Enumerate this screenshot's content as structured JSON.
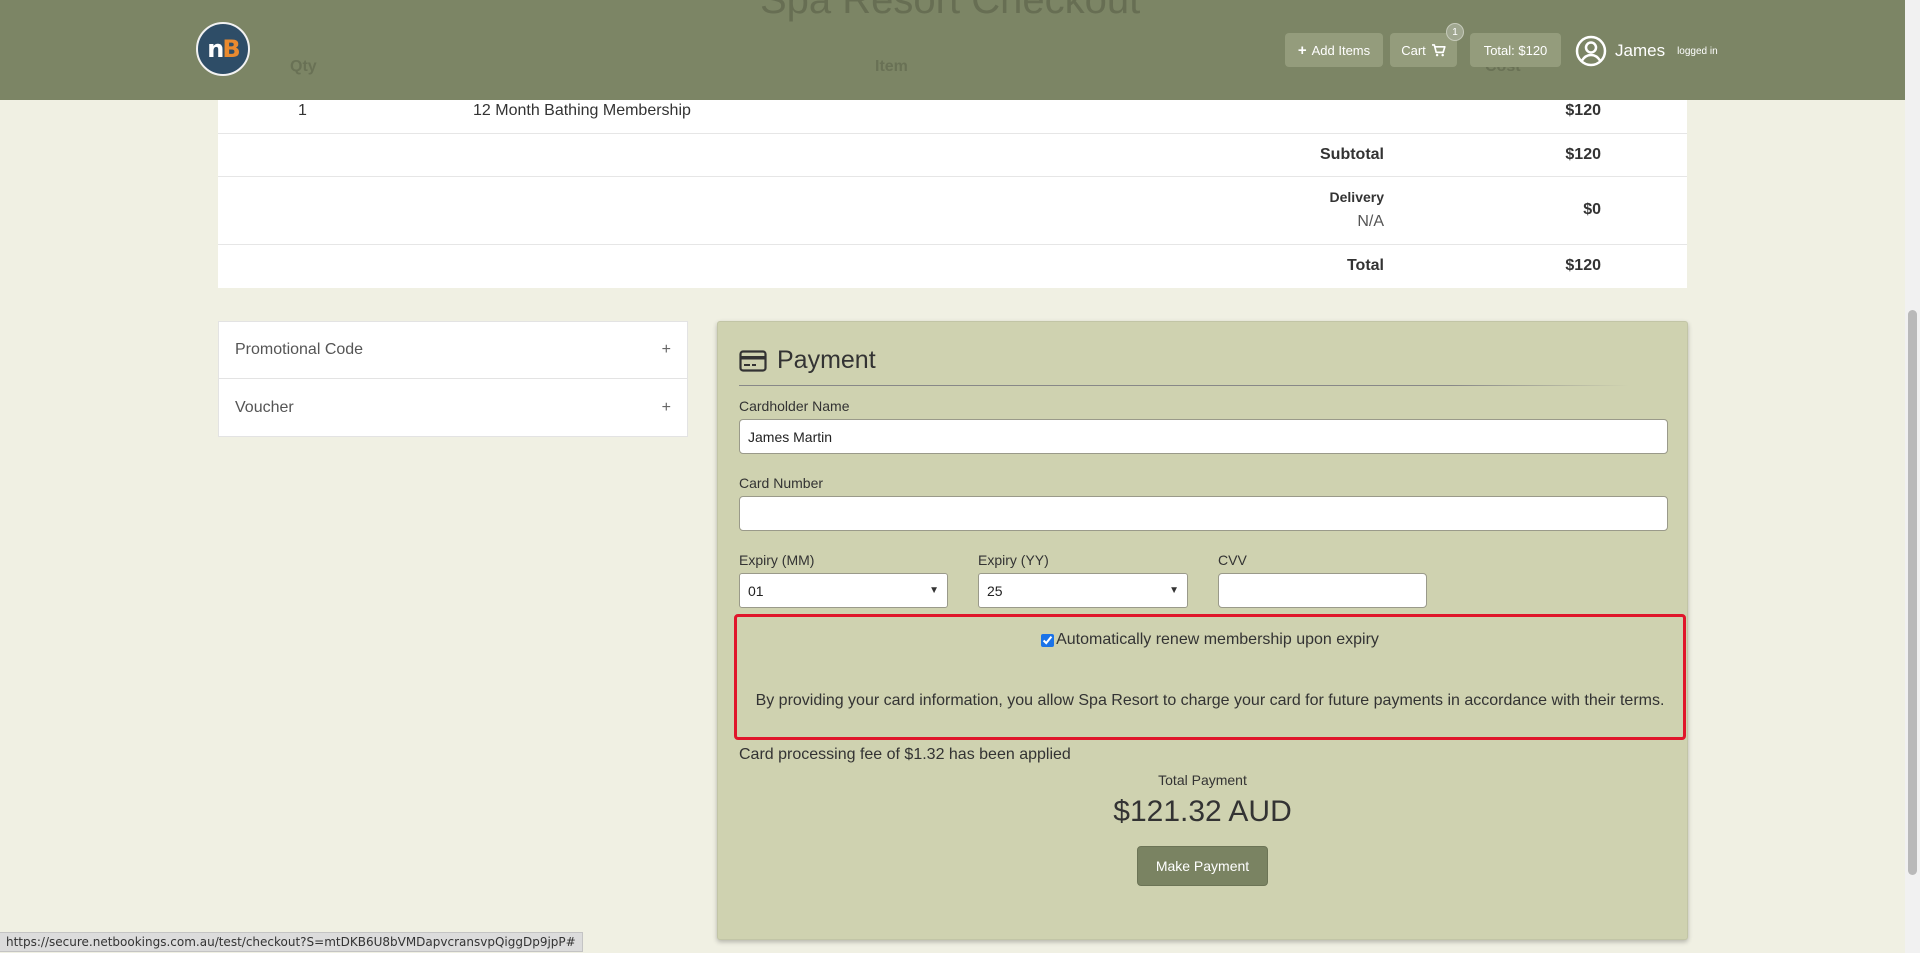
{
  "header": {
    "ghost_title": "Spa Resort Checkout",
    "add_items_label": "Add Items",
    "cart_label": "Cart",
    "cart_count": "1",
    "total_label": "Total: $120",
    "user_name": "James",
    "user_status": "logged in"
  },
  "summary": {
    "columns": {
      "qty": "Qty",
      "item": "Item",
      "cost": "Cost"
    },
    "line_item": {
      "qty": "1",
      "name": "12 Month Bathing Membership",
      "cost": "$120"
    },
    "subtotal_label": "Subtotal",
    "subtotal_value": "$120",
    "delivery_label": "Delivery",
    "delivery_method": "N/A",
    "delivery_value": "$0",
    "total_label": "Total",
    "total_value": "$120"
  },
  "sidebar": {
    "items": [
      {
        "label": "Promotional Code",
        "toggle": "+"
      },
      {
        "label": "Voucher",
        "toggle": "+"
      }
    ]
  },
  "payment": {
    "title": "Payment",
    "cardholder_label": "Cardholder Name",
    "cardholder_value": "James Martin",
    "card_number_label": "Card Number",
    "card_number_value": "",
    "expiry_mm_label": "Expiry (MM)",
    "expiry_mm_value": "01",
    "expiry_yy_label": "Expiry (YY)",
    "expiry_yy_value": "25",
    "cvv_label": "CVV",
    "cvv_value": "",
    "auto_renew_checked": true,
    "auto_renew_label": "Automatically renew membership upon expiry",
    "disclaimer": "By providing your card information, you allow Spa Resort to charge your card for future payments in accordance with their terms.",
    "fee_note": "Card processing fee of $1.32 has been applied",
    "total_payment_label": "Total Payment",
    "total_payment_value": "$121.32 AUD",
    "submit_label": "Make Payment"
  },
  "status_url": "https://secure.netbookings.com.au/test/checkout?S=mtDKB6U8bVMDapvcransvpQiggDp9jpP#",
  "colors": {
    "header_bg": "#7c8565",
    "page_bg": "#f0f0e3",
    "panel_bg": "#cfd2b0",
    "button_bg": "#7a8362",
    "highlight_border": "#e0162b",
    "logo_bg": "#2e4d67",
    "logo_accent": "#e98a2f"
  },
  "icons": {
    "logo": "nb-logo",
    "add": "plus-icon",
    "cart": "cart-icon",
    "user": "user-circle-icon",
    "payment": "credit-card-icon"
  }
}
